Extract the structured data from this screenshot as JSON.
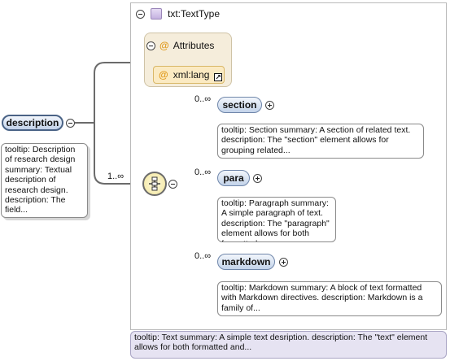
{
  "root_element": {
    "label": "description",
    "tooltip": "tooltip: Description of research design summary: Textual description of research design. description: The field..."
  },
  "connector_occurrence": "1..∞",
  "type_box": {
    "title": "txt:TextType",
    "tooltip": "tooltip: Text summary: A simple text desription. description: The \"text\" element allows for both formatted and..."
  },
  "attributes": {
    "title": "Attributes",
    "items": [
      {
        "label": "xml:lang"
      }
    ]
  },
  "children": [
    {
      "label": "section",
      "occurrence": "0..∞",
      "tooltip": "tooltip: Section summary: A section of related text. description: The \"section\" element allows for grouping related..."
    },
    {
      "label": "para",
      "occurrence": "0..∞",
      "tooltip": "tooltip: Paragraph summary: A simple paragraph of text. description: The \"paragraph\" element allows for both formatted..."
    },
    {
      "label": "markdown",
      "occurrence": "0..∞",
      "tooltip": "tooltip: Markdown summary: A block of text formatted with Markdown directives. description: Markdown is a family of..."
    }
  ],
  "icons": {
    "collapse": "minus-circle-icon",
    "expand": "plus-circle-icon",
    "type": "complex-type-icon",
    "attribute": "at-sign-icon",
    "compositor": "sequence-compositor-icon",
    "link": "external-link-icon"
  }
}
